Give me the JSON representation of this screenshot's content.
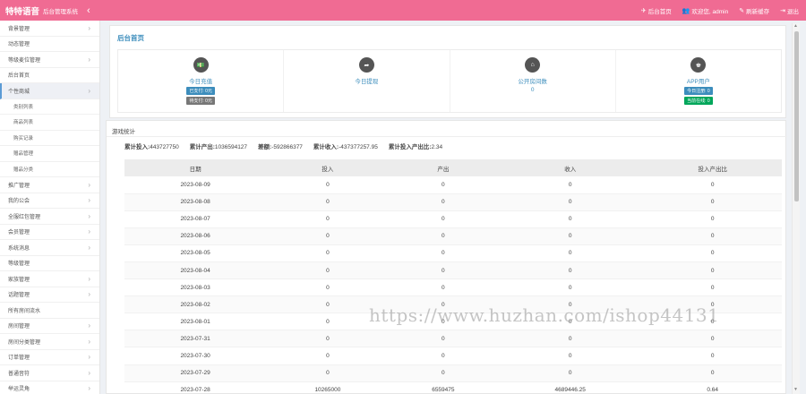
{
  "header": {
    "brand": "特特语音",
    "subtitle": "后台管理系统",
    "toggle": "‹",
    "nav": [
      {
        "icon": "✈",
        "icon_name": "home-icon",
        "label": "后台首页"
      },
      {
        "icon": "👥",
        "icon_name": "user-icon",
        "label": "欢迎您, admin"
      },
      {
        "icon": "✎",
        "icon_name": "refresh-icon",
        "label": "刷新缓存"
      },
      {
        "icon": "⇥",
        "icon_name": "logout-icon",
        "label": "退出"
      }
    ]
  },
  "sidebar": {
    "items": [
      {
        "label": "背景管理",
        "chev": "›"
      },
      {
        "label": "动态管理",
        "chev": ""
      },
      {
        "label": "等级麦位管理",
        "chev": "›"
      },
      {
        "label": "后台首页",
        "chev": ""
      },
      {
        "label": "个性商城",
        "chev": "›",
        "active": true
      },
      {
        "label": "类别列表",
        "sub": true
      },
      {
        "label": "商品列表",
        "sub": true
      },
      {
        "label": "购买记录",
        "sub": true
      },
      {
        "label": "赠品管理",
        "sub": true
      },
      {
        "label": "赠品分类",
        "sub": true
      },
      {
        "label": "推广管理",
        "chev": "›"
      },
      {
        "label": "我的公会",
        "chev": "›"
      },
      {
        "label": "全服红包管理",
        "chev": "›"
      },
      {
        "label": "会员管理",
        "chev": "›"
      },
      {
        "label": "系统消息",
        "chev": "›"
      },
      {
        "label": "等级管理",
        "chev": ""
      },
      {
        "label": "家族管理",
        "chev": "›"
      },
      {
        "label": "话题管理",
        "chev": "›"
      },
      {
        "label": "所有房间流水",
        "chev": ""
      },
      {
        "label": "房间管理",
        "chev": "›"
      },
      {
        "label": "房间分类管理",
        "chev": "›"
      },
      {
        "label": "订单管理",
        "chev": "›"
      },
      {
        "label": "普通音符",
        "chev": "›"
      },
      {
        "label": "举运灵角",
        "chev": "›"
      }
    ]
  },
  "overview": {
    "title": "后台首页",
    "stats": [
      {
        "icon": "💵",
        "icon_name": "money-icon",
        "label": "今日充值",
        "badges": [
          {
            "text": "已支付: 0元",
            "color": "blue"
          },
          {
            "text": "待支付: 0元",
            "color": "gray"
          }
        ]
      },
      {
        "icon": "➦",
        "icon_name": "withdraw-icon",
        "label": "今日提现",
        "value": ""
      },
      {
        "icon": "⌂",
        "icon_name": "house-icon",
        "label": "公开房间数",
        "value": "0"
      },
      {
        "icon": "♚",
        "icon_name": "app-user-icon",
        "label": "APP用户",
        "badges": [
          {
            "text": "今日注册: 0",
            "color": "blue"
          },
          {
            "text": "当前在线: 0",
            "color": "green"
          }
        ]
      }
    ]
  },
  "game": {
    "title": "游戏统计",
    "summary": [
      {
        "label": "累计投入:",
        "value": "443727750"
      },
      {
        "label": "累计产出:",
        "value": "1036594127"
      },
      {
        "label": "差额:",
        "value": "-592866377"
      },
      {
        "label": "累计收入:",
        "value": "-437377257.95"
      },
      {
        "label": "累计投入产出比:",
        "value": "2.34"
      }
    ],
    "columns": [
      "日期",
      "投入",
      "产出",
      "收入",
      "投入产出比"
    ],
    "rows": [
      [
        "2023-08-09",
        "0",
        "0",
        "0",
        "0"
      ],
      [
        "2023-08-08",
        "0",
        "0",
        "0",
        "0"
      ],
      [
        "2023-08-07",
        "0",
        "0",
        "0",
        "0"
      ],
      [
        "2023-08-06",
        "0",
        "0",
        "0",
        "0"
      ],
      [
        "2023-08-05",
        "0",
        "0",
        "0",
        "0"
      ],
      [
        "2023-08-04",
        "0",
        "0",
        "0",
        "0"
      ],
      [
        "2023-08-03",
        "0",
        "0",
        "0",
        "0"
      ],
      [
        "2023-08-02",
        "0",
        "0",
        "0",
        "0"
      ],
      [
        "2023-08-01",
        "0",
        "0",
        "0",
        "0"
      ],
      [
        "2023-07-31",
        "0",
        "0",
        "0",
        "0"
      ],
      [
        "2023-07-30",
        "0",
        "0",
        "0",
        "0"
      ],
      [
        "2023-07-29",
        "0",
        "0",
        "0",
        "0"
      ],
      [
        "2023-07-28",
        "10265000",
        "6559475",
        "4689446.25",
        "0.64"
      ]
    ]
  },
  "watermark": "https://www.huzhan.com/ishop44131",
  "scrollbar": {
    "up": "▲",
    "down": "▼"
  },
  "colors": {
    "header": "#f06b93",
    "accent": "#3c8dbc",
    "green": "#00a65a"
  }
}
